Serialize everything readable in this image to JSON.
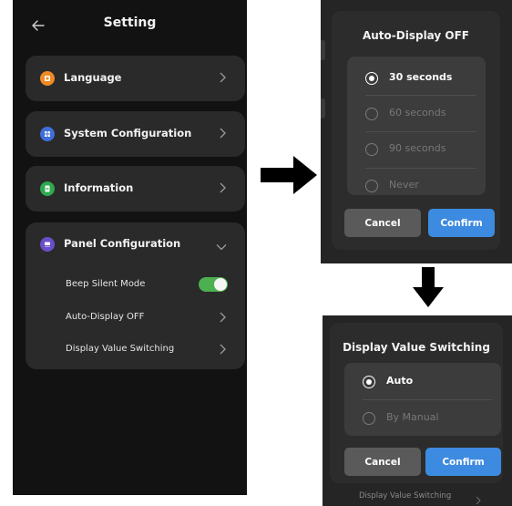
{
  "settings": {
    "title": "Setting",
    "items": [
      {
        "label": "Language",
        "icon": "language-icon",
        "color": "#f08a24"
      },
      {
        "label": "System Configuration",
        "icon": "grid-icon",
        "color": "#3f6fd8"
      },
      {
        "label": "Information",
        "icon": "document-icon",
        "color": "#2fa84f"
      },
      {
        "label": "Panel Configuration",
        "icon": "panel-icon",
        "color": "#6a4ec7"
      }
    ],
    "panel_sub": {
      "beep": "Beep Silent Mode",
      "beep_on": true,
      "auto_display": "Auto-Display OFF",
      "display_value": "Display Value Switching"
    }
  },
  "dialog_auto_display": {
    "title": "Auto-Display OFF",
    "options": [
      "30 seconds",
      "60 seconds",
      "90 seconds",
      "Never"
    ],
    "selected": "30 seconds",
    "cancel": "Cancel",
    "confirm": "Confirm"
  },
  "dialog_display_value": {
    "title": "Display Value Switching",
    "options": [
      "Auto",
      "By Manual"
    ],
    "selected": "Auto",
    "cancel": "Cancel",
    "confirm": "Confirm",
    "background_peek": "Display Value Switching"
  },
  "colors": {
    "accent": "#3d8be0",
    "toggle_on": "#4caf50"
  }
}
